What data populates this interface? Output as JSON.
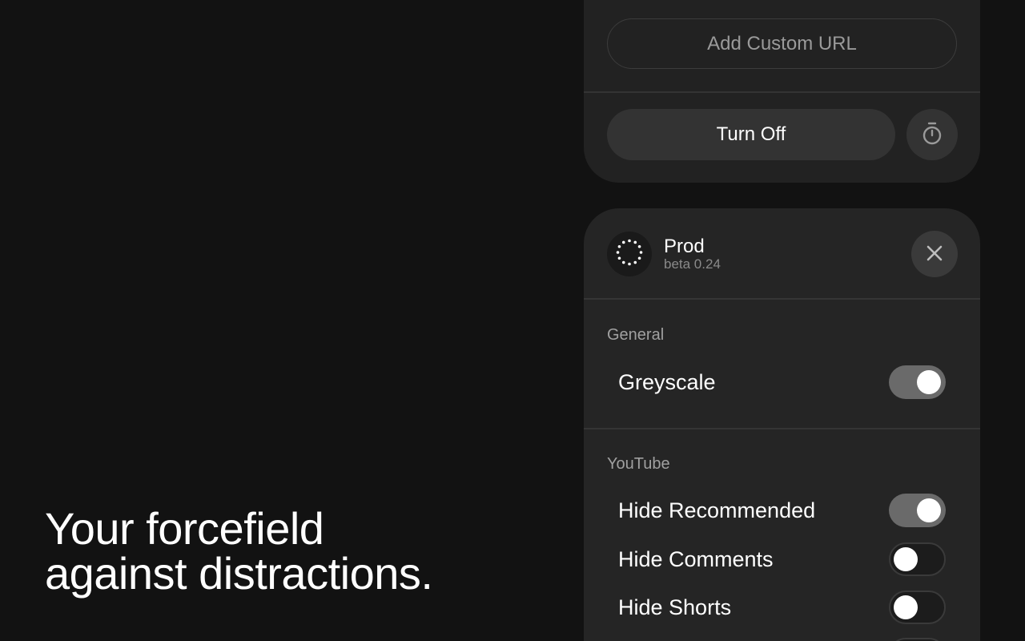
{
  "tagline": {
    "line1": "Your forcefield",
    "line2": "against distractions."
  },
  "top_card": {
    "add_url_label": "Add Custom URL",
    "turn_off_label": "Turn Off",
    "timer_icon": "stopwatch-icon"
  },
  "app": {
    "name": "Prod",
    "version": "beta 0.24",
    "logo_icon": "dotted-circle-icon",
    "close_icon": "close-icon"
  },
  "sections": {
    "general": {
      "label": "General",
      "items": [
        {
          "label": "Greyscale",
          "enabled": true
        }
      ]
    },
    "youtube": {
      "label": "YouTube",
      "items": [
        {
          "label": "Hide Recommended",
          "enabled": true
        },
        {
          "label": "Hide Comments",
          "enabled": false
        },
        {
          "label": "Hide Shorts",
          "enabled": false
        }
      ]
    }
  },
  "colors": {
    "background": "#121212",
    "card": "#252525",
    "toggle_on": "#6a6a6a",
    "toggle_off": "#1c1c1c"
  }
}
